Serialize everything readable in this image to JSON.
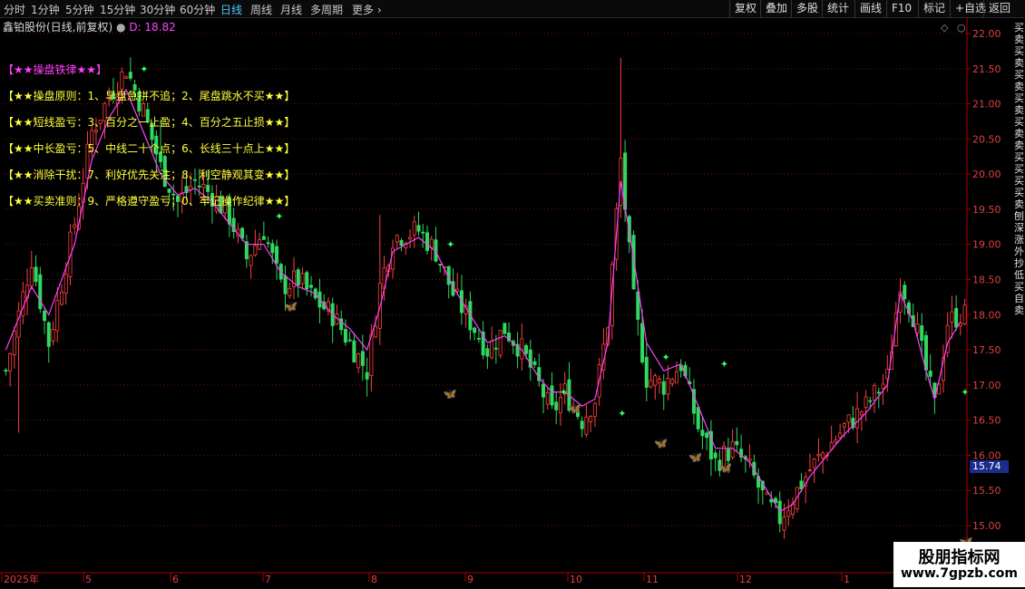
{
  "toolbar": {
    "periods": [
      "分时",
      "1分钟",
      "5分钟",
      "15分钟",
      "30分钟",
      "60分钟",
      "日线",
      "周线",
      "月线",
      "多周期",
      "更多"
    ],
    "active_period": "日线",
    "buttons": [
      "复权",
      "叠加",
      "多股",
      "统计",
      "画线",
      "F10",
      "标记",
      "+自选",
      "返回"
    ]
  },
  "header": {
    "stock_name": "鑫铂股份(日线,前复权)",
    "d_value": "D: 18.82"
  },
  "annotations": [
    "【★★操盘铁律★★】",
    "【★★操盘原则：1、早盘急拼不追；2、尾盘跳水不买★★】",
    "【★★短线盈亏：3、百分之一止盈；4、百分之五止损★★】",
    "【★★中长盈亏：5、中线二十个点；6、长线三十点上★★】",
    "【★★消除干扰：7、利好优先关注；8、利空静观其变★★】",
    "【★★买卖准则：9、严格遵守盈亏；0、牢记操作纪律★★】"
  ],
  "right_strip_text": "买卖买卖买卖买卖买卖卖买买买买卖刨深涨外抄低买自卖",
  "price_tag": "15.74",
  "watermark": {
    "title": "股朋指标网",
    "url": "www.7gpzb.com"
  },
  "colors": {
    "up": "#ff4040",
    "down": "#30d860",
    "ma": "#ff40ff",
    "grid": "#7a1010",
    "axis": "#b00000"
  },
  "chart_data": {
    "type": "candlestick",
    "y_axis": {
      "min": 15.0,
      "max": 22.0,
      "step": 0.5,
      "tick_labels": [
        "15.00",
        "15.50",
        "16.00",
        "16.50",
        "17.00",
        "17.50",
        "18.00",
        "18.50",
        "19.00",
        "19.50",
        "20.00",
        "20.50",
        "21.00",
        "21.50",
        "22.00"
      ]
    },
    "x_axis": {
      "labels": [
        "2025年",
        "5",
        "6",
        "7",
        "8",
        "9",
        "10",
        "11",
        "12",
        "1"
      ]
    },
    "close_points": [
      [
        0,
        17.2
      ],
      [
        6,
        18.8
      ],
      [
        10,
        17.6
      ],
      [
        16,
        19.3
      ],
      [
        20,
        20.6
      ],
      [
        24,
        21.1
      ],
      [
        28,
        21.5
      ],
      [
        32,
        20.9
      ],
      [
        36,
        20.1
      ],
      [
        40,
        19.6
      ],
      [
        44,
        19.9
      ],
      [
        48,
        19.7
      ],
      [
        52,
        19.4
      ],
      [
        56,
        18.8
      ],
      [
        60,
        19.2
      ],
      [
        64,
        18.4
      ],
      [
        68,
        18.5
      ],
      [
        72,
        18.2
      ],
      [
        76,
        18.0
      ],
      [
        80,
        17.6
      ],
      [
        84,
        17.2
      ],
      [
        87,
        18.4
      ],
      [
        90,
        19.1
      ],
      [
        96,
        19.2
      ],
      [
        100,
        18.9
      ],
      [
        104,
        18.3
      ],
      [
        108,
        17.9
      ],
      [
        112,
        17.5
      ],
      [
        116,
        17.8
      ],
      [
        120,
        17.5
      ],
      [
        124,
        17.0
      ],
      [
        127,
        16.6
      ],
      [
        130,
        16.9
      ],
      [
        134,
        16.5
      ],
      [
        137,
        16.8
      ],
      [
        140,
        17.9
      ],
      [
        143,
        20.2
      ],
      [
        146,
        18.2
      ],
      [
        149,
        17.1
      ],
      [
        153,
        17.0
      ],
      [
        157,
        17.3
      ],
      [
        161,
        16.4
      ],
      [
        165,
        15.9
      ],
      [
        169,
        16.1
      ],
      [
        173,
        15.8
      ],
      [
        177,
        15.3
      ],
      [
        180,
        15.1
      ],
      [
        183,
        15.4
      ],
      [
        187,
        15.8
      ],
      [
        191,
        16.1
      ],
      [
        195,
        16.4
      ],
      [
        200,
        16.7
      ],
      [
        205,
        17.1
      ],
      [
        208,
        18.5
      ],
      [
        211,
        18.0
      ],
      [
        214,
        17.2
      ],
      [
        216,
        16.7
      ],
      [
        219,
        17.9
      ],
      [
        222,
        18.0
      ]
    ],
    "ma_points": [
      [
        0,
        17.5
      ],
      [
        6,
        18.4
      ],
      [
        10,
        18.0
      ],
      [
        16,
        19.0
      ],
      [
        20,
        20.2
      ],
      [
        24,
        20.8
      ],
      [
        28,
        21.2
      ],
      [
        32,
        20.6
      ],
      [
        36,
        20.0
      ],
      [
        40,
        19.7
      ],
      [
        44,
        19.8
      ],
      [
        48,
        19.6
      ],
      [
        52,
        19.3
      ],
      [
        56,
        19.0
      ],
      [
        60,
        19.0
      ],
      [
        64,
        18.6
      ],
      [
        68,
        18.4
      ],
      [
        72,
        18.3
      ],
      [
        76,
        18.0
      ],
      [
        80,
        17.8
      ],
      [
        84,
        17.5
      ],
      [
        87,
        18.1
      ],
      [
        90,
        18.9
      ],
      [
        96,
        19.1
      ],
      [
        100,
        18.9
      ],
      [
        104,
        18.4
      ],
      [
        108,
        18.0
      ],
      [
        112,
        17.6
      ],
      [
        116,
        17.7
      ],
      [
        120,
        17.5
      ],
      [
        124,
        17.1
      ],
      [
        127,
        16.9
      ],
      [
        130,
        16.9
      ],
      [
        134,
        16.7
      ],
      [
        137,
        16.8
      ],
      [
        140,
        17.6
      ],
      [
        143,
        19.9
      ],
      [
        146,
        18.8
      ],
      [
        149,
        17.6
      ],
      [
        153,
        17.2
      ],
      [
        157,
        17.3
      ],
      [
        161,
        16.7
      ],
      [
        165,
        16.1
      ],
      [
        169,
        16.1
      ],
      [
        173,
        15.9
      ],
      [
        177,
        15.5
      ],
      [
        180,
        15.2
      ],
      [
        183,
        15.3
      ],
      [
        187,
        15.7
      ],
      [
        191,
        16.0
      ],
      [
        195,
        16.3
      ],
      [
        200,
        16.6
      ],
      [
        205,
        17.0
      ],
      [
        208,
        18.3
      ],
      [
        211,
        17.9
      ],
      [
        214,
        17.2
      ],
      [
        216,
        16.8
      ],
      [
        219,
        17.6
      ],
      [
        222,
        17.9
      ]
    ],
    "butterflies": [
      [
        66,
        18.2
      ],
      [
        103,
        16.95
      ],
      [
        132,
        16.75
      ],
      [
        152,
        16.25
      ],
      [
        160,
        16.05
      ],
      [
        167,
        15.9
      ],
      [
        223,
        14.85
      ]
    ],
    "star_markers": [
      [
        38,
        21.5
      ],
      [
        75,
        19.4
      ],
      [
        122,
        19.0
      ],
      [
        153,
        16.9
      ],
      [
        169,
        16.6
      ],
      [
        181,
        17.4
      ],
      [
        197,
        17.3
      ],
      [
        263,
        16.9
      ]
    ]
  }
}
